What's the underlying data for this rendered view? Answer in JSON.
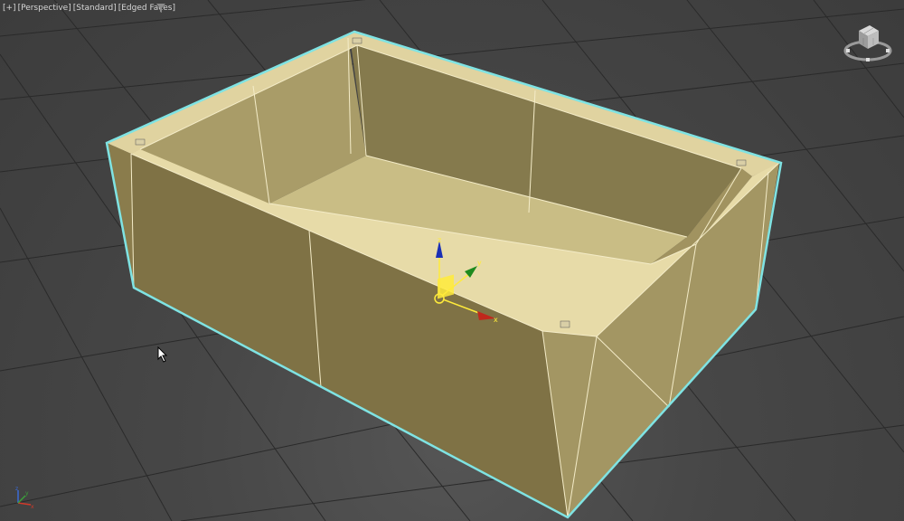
{
  "viewport": {
    "label": {
      "menu": "[+]",
      "view": "[Perspective]",
      "shading": "[Standard]",
      "display": "[Edged Faces]"
    },
    "filter_icon": "filter-funnel-icon",
    "viewcube_icon": "viewcube-icon",
    "cursor_icon": "arrow-cursor-icon",
    "axis_tripod_icon": "world-axis-tripod-icon"
  },
  "gizmo": {
    "axis_z": "z",
    "axis_y": "y",
    "axis_x": "x"
  },
  "colors": {
    "background": "#3a3a3a",
    "grid": "#2b2b2b",
    "object": "#c8b878",
    "selection_outline": "#7fe3e3",
    "axis_x": "#c0281c",
    "axis_y": "#1e8a1e",
    "axis_z": "#1a2fb5",
    "gizmo_plane": "#ffeb3b"
  }
}
